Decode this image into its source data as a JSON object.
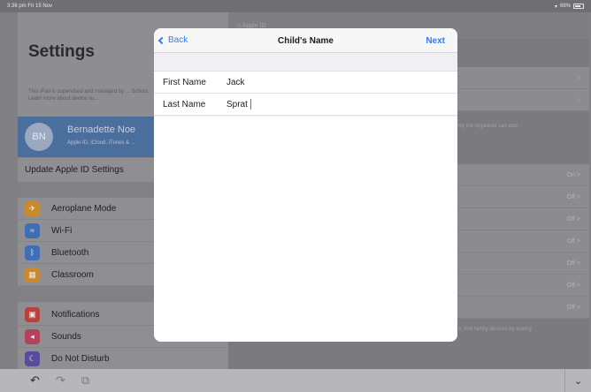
{
  "status_bar": {
    "time": "3:36 pm  Fri 15 Nov",
    "battery": "68%"
  },
  "background": {
    "title": "Settings",
    "supervised_text": "This iPad is supervised and managed by ... School. Learn more about device su...",
    "profile": {
      "initials": "BN",
      "name": "Bernadette Noe",
      "subtitle": "Apple ID, iCloud, iTunes & ..."
    },
    "update_row": "Update Apple ID Settings",
    "list_group_1": [
      {
        "label": "Aeroplane Mode",
        "icon": "airplane-icon",
        "color": "#c98a2e"
      },
      {
        "label": "Wi-Fi",
        "icon": "wifi-icon",
        "color": "#3d6fb5"
      },
      {
        "label": "Bluetooth",
        "icon": "bluetooth-icon",
        "color": "#3d6fb5"
      },
      {
        "label": "Classroom",
        "icon": "classroom-icon",
        "color": "#c98a2e"
      }
    ],
    "list_group_2": [
      {
        "label": "Notifications",
        "icon": "notifications-icon",
        "color": "#b4423d"
      },
      {
        "label": "Sounds",
        "icon": "sounds-icon",
        "color": "#b4425a"
      },
      {
        "label": "Do Not Disturb",
        "icon": "moon-icon",
        "color": "#5a4a9c"
      }
    ],
    "right_pane": {
      "nav_title": "< Apple ID",
      "note_organiser": "only the organiser can add",
      "note_find": "e, find family devices by asking",
      "values": [
        "On >",
        "Off >",
        "Off >",
        "Off >",
        "Off >",
        "Off >",
        "Off >"
      ]
    }
  },
  "sheet": {
    "back_label": "Back",
    "title": "Child's Name",
    "next_label": "Next",
    "fields": [
      {
        "label": "First Name",
        "value": "Jack"
      },
      {
        "label": "Last Name",
        "value": "Sprat"
      }
    ]
  },
  "toolbar": {
    "undo": "↶",
    "redo": "↷",
    "paste": "⧉",
    "dismiss": "⌄"
  },
  "colors": {
    "accent": "#2f7cf6"
  }
}
